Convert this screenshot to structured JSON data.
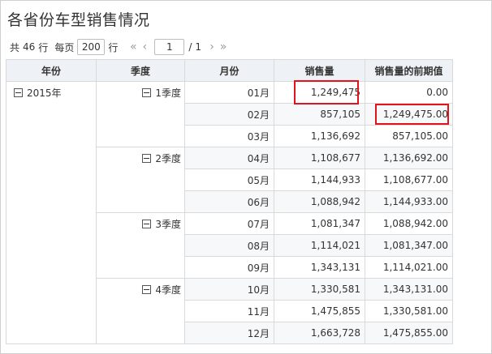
{
  "title": "各省份车型销售情况",
  "pager": {
    "total_prefix": "共",
    "total": "46",
    "total_suffix": "行",
    "per_page_label": "每页",
    "page_size": "200",
    "rows_label": "行",
    "current_page": "1",
    "pages_sep": "/",
    "total_pages": "1"
  },
  "table": {
    "headers": [
      "年份",
      "季度",
      "月份",
      "销售量",
      "销售量的前期值"
    ],
    "year": "2015年",
    "quarters": [
      "1季度",
      "2季度",
      "3季度",
      "4季度"
    ],
    "rows": [
      {
        "month": "01月",
        "sales": "1,249,475",
        "prev": "0.00"
      },
      {
        "month": "02月",
        "sales": "857,105",
        "prev": "1,249,475.00"
      },
      {
        "month": "03月",
        "sales": "1,136,692",
        "prev": "857,105.00"
      },
      {
        "month": "04月",
        "sales": "1,108,677",
        "prev": "1,136,692.00"
      },
      {
        "month": "05月",
        "sales": "1,144,933",
        "prev": "1,108,677.00"
      },
      {
        "month": "06月",
        "sales": "1,088,942",
        "prev": "1,144,933.00"
      },
      {
        "month": "07月",
        "sales": "1,081,347",
        "prev": "1,088,942.00"
      },
      {
        "month": "08月",
        "sales": "1,114,021",
        "prev": "1,081,347.00"
      },
      {
        "month": "09月",
        "sales": "1,343,131",
        "prev": "1,114,021.00"
      },
      {
        "month": "10月",
        "sales": "1,330,581",
        "prev": "1,343,131.00"
      },
      {
        "month": "11月",
        "sales": "1,475,855",
        "prev": "1,330,581.00"
      },
      {
        "month": "12月",
        "sales": "1,663,728",
        "prev": "1,475,855.00"
      }
    ]
  },
  "colors": {
    "highlight_border": "#e2141b",
    "header_bg": "#eef1f5",
    "grid_line": "#d9d9d9"
  },
  "icons": {
    "collapse": "minus-square-icon",
    "first_page": "double-chevron-left-icon",
    "prev_page": "chevron-left-icon",
    "next_page": "chevron-right-icon",
    "last_page": "double-chevron-right-icon"
  }
}
